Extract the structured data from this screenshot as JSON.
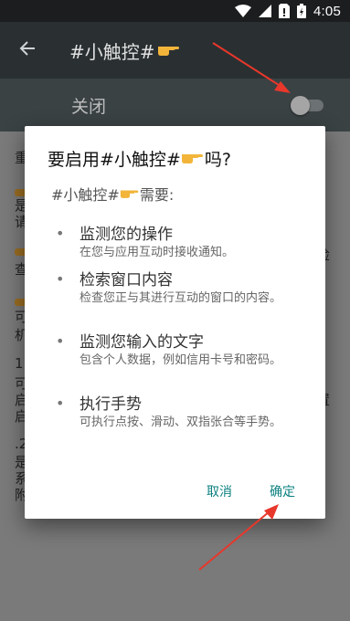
{
  "status_bar": {
    "time": "4:05"
  },
  "app_bar": {
    "title_prefix": "#小触控#"
  },
  "switch_row": {
    "label": "关闭",
    "state": "off"
  },
  "background": {
    "line1": "重",
    "line2a": "是",
    "line2b": "请",
    "line3": "查",
    "line3_right": "检",
    "line4a": "可",
    "line4b": "机",
    "line5a": "1",
    "line5b": "可",
    "line5c": "启",
    "line5d": "启",
    "line5_right": "置",
    "line6a": ".2",
    "line6b": "是",
    "line6c": "系",
    "line6d": "附"
  },
  "dialog": {
    "title_prefix": "要启用#小触控#",
    "title_suffix": "吗?",
    "subtitle_prefix": "#小触控#",
    "subtitle_suffix": "需要:",
    "permissions": [
      {
        "title": "监测您的操作",
        "desc": "在您与应用互动时接收通知。"
      },
      {
        "title": "检索窗口内容",
        "desc": "检查您正与其进行互动的窗口的内容。"
      },
      {
        "title": "监测您输入的文字",
        "desc": "包含个人数据，例如信用卡号和密码。"
      },
      {
        "title": "执行手势",
        "desc": "可执行点按、滑动、双指张合等手势。"
      }
    ],
    "cancel_label": "取消",
    "ok_label": "确定"
  },
  "colors": {
    "accent": "#0d8080",
    "arrow": "#e8372b",
    "app_bar": "#2a3032",
    "hand": "#f2b53a"
  },
  "icons": [
    "wifi-icon",
    "signal-icon",
    "no-sim-icon",
    "battery-icon",
    "back-arrow-icon",
    "pointing-hand-icon"
  ]
}
